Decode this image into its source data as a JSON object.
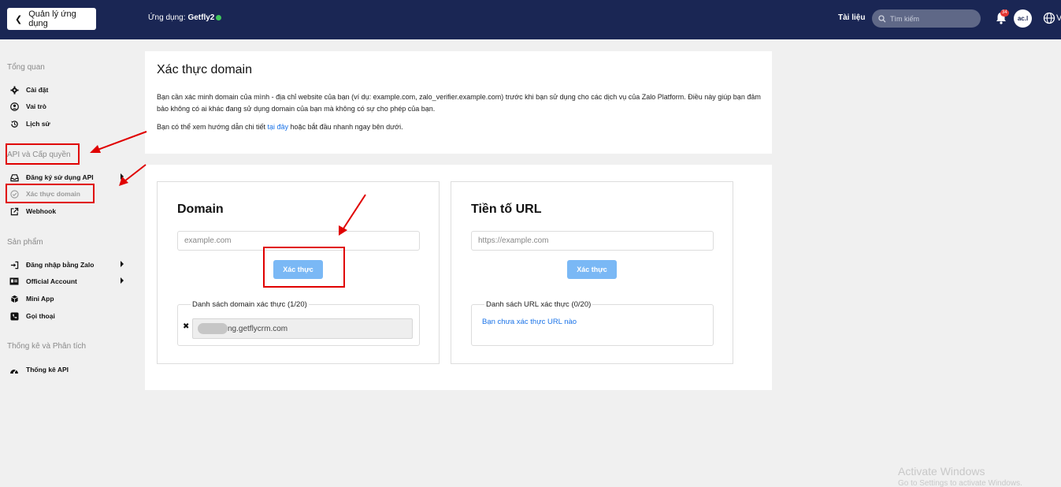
{
  "topbar": {
    "back_label": "Quản lý ứng dụng",
    "app_prefix": "Ứng dụng:",
    "app_name": "Getfly2",
    "docs_label": "Tài liệu",
    "search_placeholder": "Tìm kiếm",
    "notification_count": "34",
    "avatar_text": "ac.l",
    "lang_label": "V"
  },
  "sidebar": {
    "overview": {
      "title": "Tổng quan",
      "items": [
        {
          "label": "Cài đặt",
          "icon": "gear-icon"
        },
        {
          "label": "Vai trò",
          "icon": "user-circle-icon"
        },
        {
          "label": "Lịch sử",
          "icon": "history-icon"
        }
      ]
    },
    "api": {
      "title": "API và Cấp quyền",
      "items": [
        {
          "label": "Đăng ký sử dụng API",
          "icon": "inbox-icon"
        },
        {
          "label": "Xác thực domain",
          "icon": "check-circle-icon"
        },
        {
          "label": "Webhook",
          "icon": "external-link-icon"
        }
      ]
    },
    "products": {
      "title": "Sản phẩm",
      "items": [
        {
          "label": "Đăng nhập bằng Zalo",
          "icon": "login-icon"
        },
        {
          "label": "Official Account",
          "icon": "id-card-icon"
        },
        {
          "label": "Mini App",
          "icon": "cube-icon"
        },
        {
          "label": "Gọi thoại",
          "icon": "phone-icon"
        }
      ]
    },
    "stats": {
      "title": "Thống kê và Phân tích",
      "items": [
        {
          "label": "Thống kê API",
          "icon": "chart-icon"
        }
      ]
    }
  },
  "intro": {
    "title": "Xác thực domain",
    "para1": "Bạn cần xác minh domain của mình - địa chỉ website của bạn (ví dụ: example.com, zalo_verifier.example.com) trước khi bạn sử dụng cho các dịch vụ của Zalo Platform. Điều này giúp bạn đảm bảo không có ai khác đang sử dụng domain của bạn mà không có sự cho phép của bạn.",
    "para2_before": "Bạn có thể xem hướng dẫn chi tiết ",
    "para2_link": "tại đây",
    "para2_after": " hoặc bắt đầu nhanh ngay bên dưới."
  },
  "domain_panel": {
    "title": "Domain",
    "placeholder": "example.com",
    "button": "Xác thực",
    "list_title": "Danh sách domain xác thực (1/20)",
    "entry": "ng.getflycrm.com"
  },
  "url_panel": {
    "title": "Tiền tố URL",
    "placeholder": "https://example.com",
    "button": "Xác thực",
    "list_title": "Danh sách URL xác thực (0/20)",
    "empty": "Bạn chưa xác thực URL nào"
  },
  "watermark": {
    "line1": "Activate Windows",
    "line2": "Go to Settings to activate Windows."
  },
  "colors": {
    "topbar": "#1a2654",
    "annotation": "#e00000",
    "button": "#7ab8f5",
    "link": "#1a73e8"
  }
}
